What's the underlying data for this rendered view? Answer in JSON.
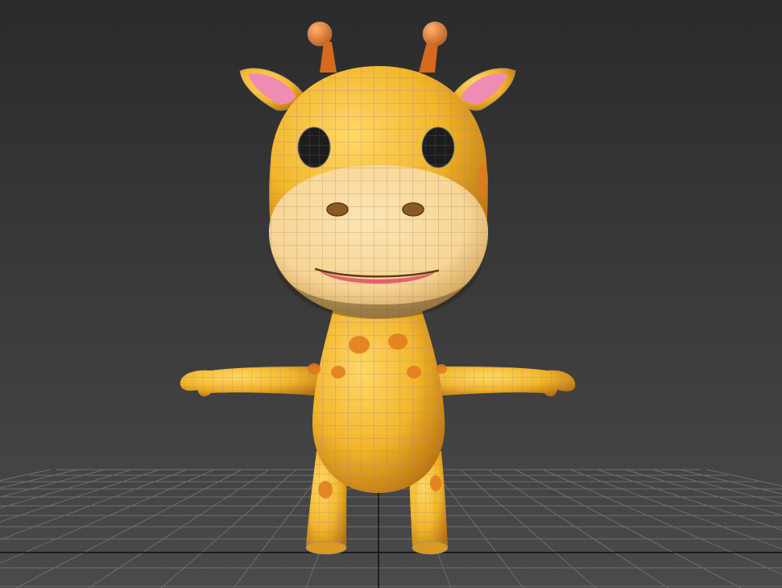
{
  "viewport": {
    "background_top": "#2b2b2b",
    "background_bottom": "#4a4a4a",
    "grid_color": "#6e6e6e",
    "grid_axis_color": "#111111"
  },
  "model": {
    "kind": "giraffe-character",
    "wireframe_overlay": true,
    "colors": {
      "body": "#f3b52a",
      "body_shadow": "#b8700f",
      "muzzle": "#f8d594",
      "spots": "#e07a1c",
      "horns": "#e8782a",
      "ear_inner": "#ee8cb4",
      "mouth": "#e0626e",
      "eyes": "#1c1c1c",
      "wire": "#8d8d8d"
    }
  }
}
